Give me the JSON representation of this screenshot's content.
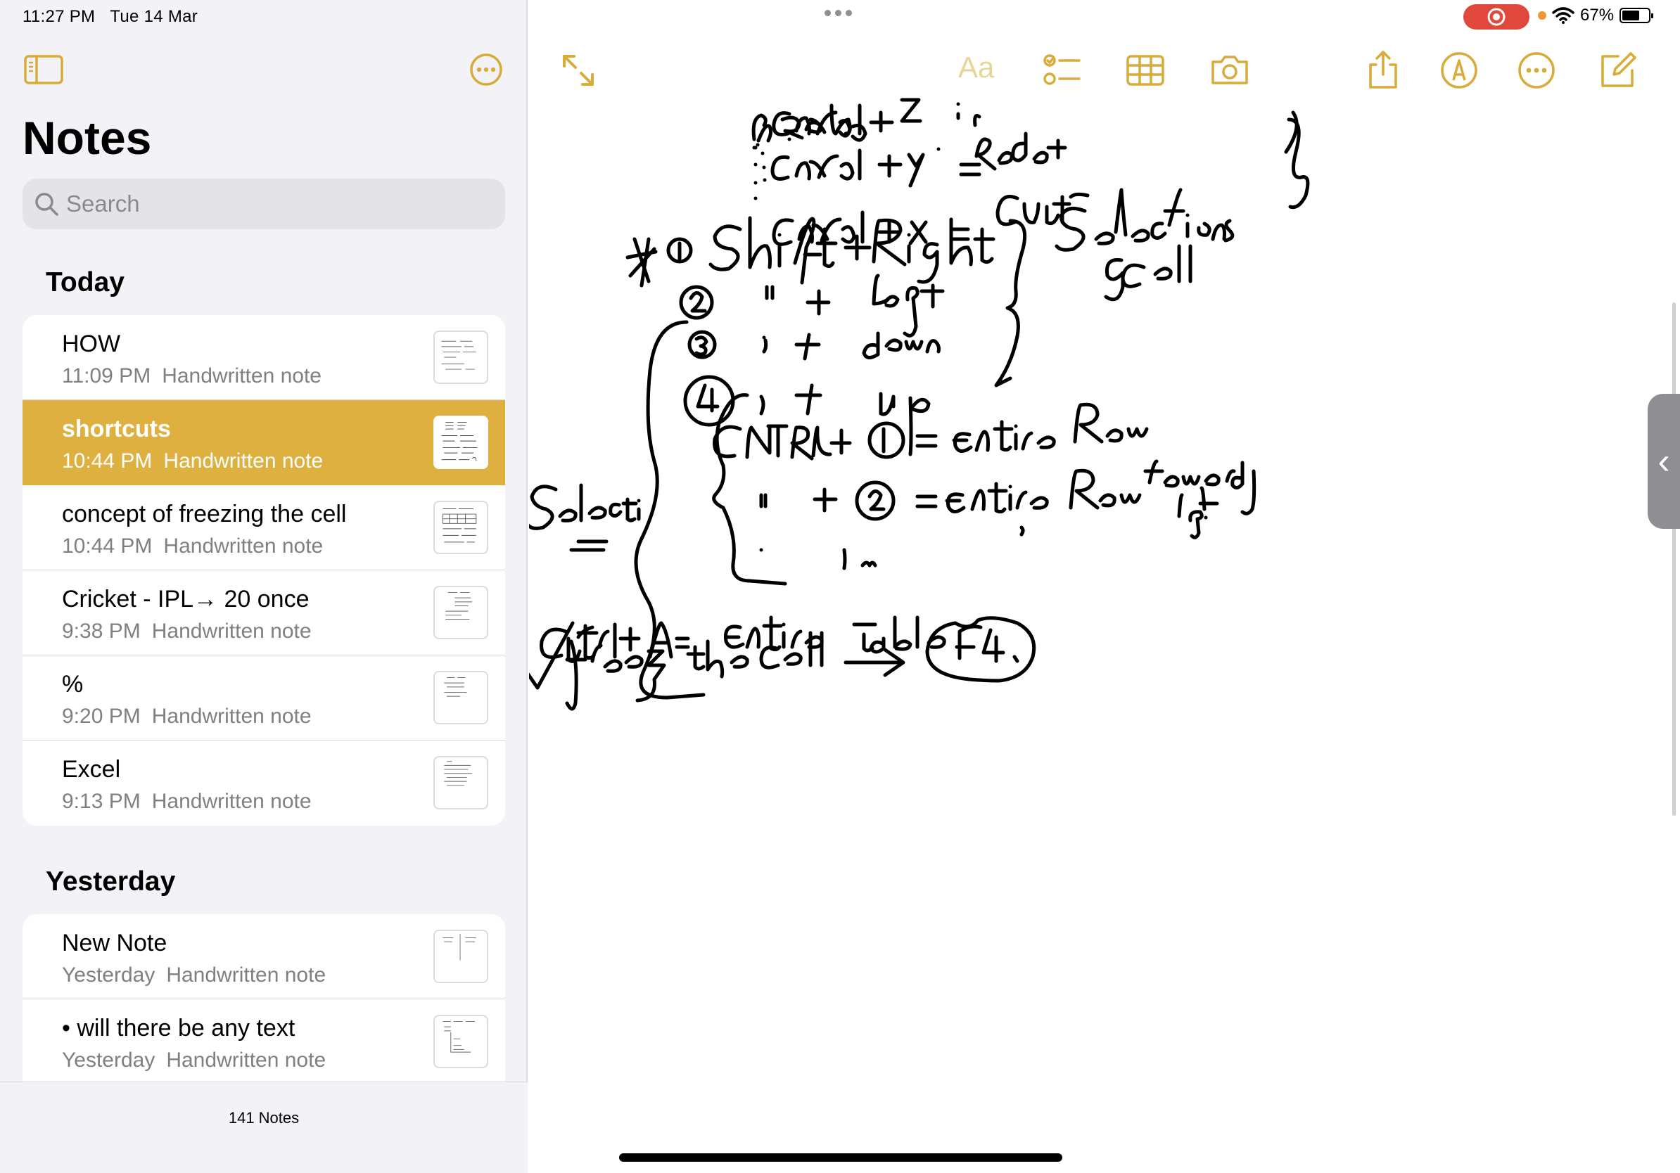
{
  "status": {
    "time": "11:27 PM",
    "date": "Tue 14 Mar",
    "battery": "67%",
    "battery_level": 0.67
  },
  "sidebar": {
    "title": "Notes",
    "search_placeholder": "Search",
    "sections": [
      {
        "heading": "Today",
        "notes": [
          {
            "title": "HOW",
            "time": "11:09 PM",
            "kind": "Handwritten note",
            "selected": false
          },
          {
            "title": "shortcuts",
            "time": "10:44 PM",
            "kind": "Handwritten note",
            "selected": true
          },
          {
            "title": "concept of freezing the cell",
            "time": "10:44 PM",
            "kind": "Handwritten note",
            "selected": false
          },
          {
            "title": "Cricket - IPL→ 20 once",
            "time": "9:38 PM",
            "kind": "Handwritten note",
            "selected": false
          },
          {
            "title": "%",
            "time": "9:20 PM",
            "kind": "Handwritten note",
            "selected": false
          },
          {
            "title": "Excel",
            "time": "9:13 PM",
            "kind": "Handwritten note",
            "selected": false
          }
        ]
      },
      {
        "heading": "Yesterday",
        "notes": [
          {
            "title": "New Note",
            "time": "Yesterday",
            "kind": "Handwritten note",
            "selected": false
          },
          {
            "title": "• will there be any text",
            "time": "Yesterday",
            "kind": "Handwritten note",
            "selected": false
          }
        ]
      }
    ],
    "note_count": "141 Notes"
  },
  "toolbar": {
    "format_label": "Aa"
  },
  "colors": {
    "accent": "#ddb040",
    "ink": "#000000",
    "sidebar_bg": "#f2f2f7"
  },
  "handwriting": {
    "lines_top": [
      "Cntrl + Z =",
      "Cntrl + Y =",
      "Redo",
      "Cntrl + X =",
      "Cut"
    ],
    "selection_block": [
      "1 Shift + Right",
      "2 ” + left",
      "3 ” + down",
      "4 ” + up",
      "Selections of cell"
    ],
    "row_block": [
      "CNTRL + 1 = Entire Row",
      "” + 2 = Entire Row towards left",
      "”",
      "Selection"
    ],
    "bottom": [
      "Cntrl + A = Entire table",
      "✓ freeze the cell →",
      "F4"
    ]
  }
}
